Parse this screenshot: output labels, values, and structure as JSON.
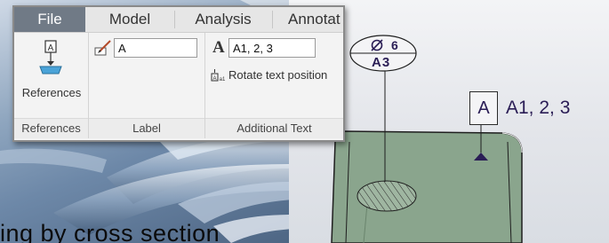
{
  "ribbon": {
    "tabs": [
      {
        "label": "File"
      },
      {
        "label": "Model"
      },
      {
        "label": "Analysis"
      },
      {
        "label": "Annotat"
      }
    ],
    "groups": {
      "references": {
        "title": "References",
        "button_label": "References",
        "icon": "references-icon"
      },
      "label": {
        "title": "Label",
        "input_value": "A",
        "icon": "label-edit-icon"
      },
      "additional_text": {
        "title": "Additional Text",
        "input_value": "A1, 2, 3",
        "rotate_label": "Rotate text position",
        "style_glyph": "A",
        "icons": [
          "text-style-icon",
          "rotate-text-icon"
        ]
      }
    }
  },
  "viewport": {
    "dimension": {
      "value": "6",
      "reference": "A3",
      "symbol": "diameter-icon"
    },
    "datum_label": "A",
    "additional_text": "A1, 2, 3"
  },
  "background": {
    "caption": "ing by cross section"
  },
  "colors": {
    "file_tab": "#707a86",
    "annotation_text": "#2a1d55",
    "model_face": "#8aa58d"
  }
}
